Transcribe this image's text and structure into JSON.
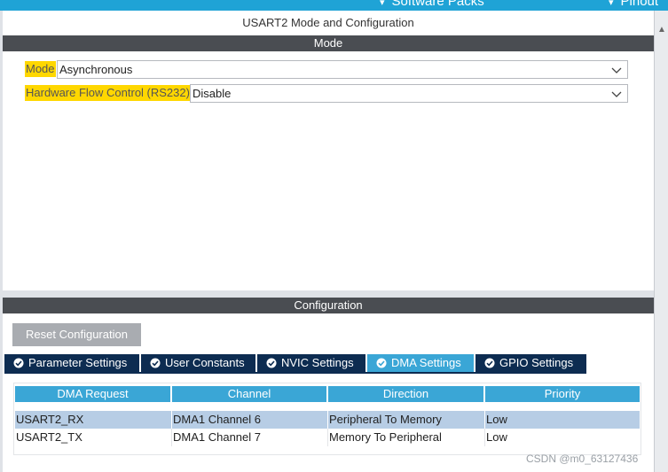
{
  "top_nav": {
    "item1": "Software Packs",
    "item2": "Pinout",
    "chevron1": "▾",
    "chevron2": "▾"
  },
  "title": "USART2 Mode and Configuration",
  "mode_section": {
    "header": "Mode",
    "fields": [
      {
        "label": "Mode",
        "value": "Asynchronous"
      },
      {
        "label": "Hardware Flow Control (RS232)",
        "value": "Disable"
      }
    ]
  },
  "config_section": {
    "header": "Configuration",
    "reset_button": "Reset Configuration",
    "tabs": [
      {
        "label": "Parameter Settings",
        "active": false
      },
      {
        "label": "User Constants",
        "active": false
      },
      {
        "label": "NVIC Settings",
        "active": false
      },
      {
        "label": "DMA Settings",
        "active": true
      },
      {
        "label": "GPIO Settings",
        "active": false
      }
    ],
    "dma_table": {
      "columns": [
        "DMA Request",
        "Channel",
        "Direction",
        "Priority"
      ],
      "rows": [
        {
          "request": "USART2_RX",
          "channel": "DMA1 Channel 6",
          "direction": "Peripheral To Memory",
          "priority": "Low",
          "selected": true
        },
        {
          "request": "USART2_TX",
          "channel": "DMA1 Channel 7",
          "direction": "Memory To Peripheral",
          "priority": "Low",
          "selected": false
        }
      ]
    }
  },
  "watermark": "CSDN @m0_63127436",
  "icons": {
    "dropdown": "chevron-down-icon",
    "tab_check": "check-circle-icon",
    "scroll_up": "triangle-up-icon"
  },
  "colors": {
    "accent_blue": "#3aa6d6",
    "tab_navy": "#0d2c51",
    "header_gray": "#4a4d52",
    "highlight_yellow": "#ffd700",
    "selected_row": "#b7cde5"
  }
}
